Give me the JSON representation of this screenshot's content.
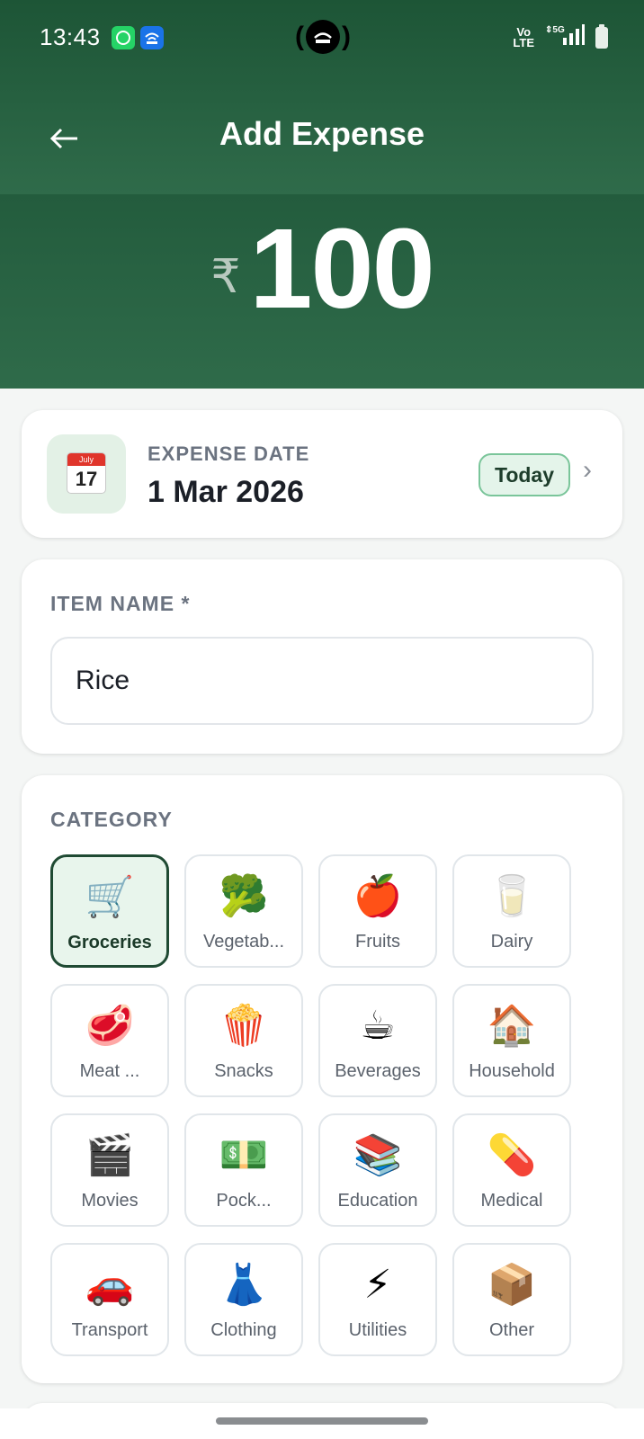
{
  "status_bar": {
    "time": "13:43",
    "network_volte": "Vo\nLTE",
    "network_type": "5G"
  },
  "header": {
    "title": "Add Expense",
    "back_icon": "arrow-left-icon",
    "currency_symbol": "₹",
    "amount": "100"
  },
  "date_card": {
    "label": "EXPENSE DATE",
    "value": "1 Mar 2026",
    "calendar_month": "July",
    "calendar_day": "17",
    "badge": "Today",
    "chevron": "›"
  },
  "item_card": {
    "label": "ITEM NAME *",
    "value": "Rice"
  },
  "category_card": {
    "label": "CATEGORY",
    "selected": "Groceries",
    "items": [
      {
        "label": "Groceries",
        "emoji": "🛒",
        "icon": "shopping-cart-icon"
      },
      {
        "label": "Vegetab...",
        "emoji": "🥦",
        "icon": "broccoli-icon"
      },
      {
        "label": "Fruits",
        "emoji": "🍎",
        "icon": "apple-icon"
      },
      {
        "label": "Dairy",
        "emoji": "🥛",
        "icon": "milk-glass-icon"
      },
      {
        "label": "Meat ...",
        "emoji": "🥩",
        "icon": "meat-icon"
      },
      {
        "label": "Snacks",
        "emoji": "🍿",
        "icon": "popcorn-icon"
      },
      {
        "label": "Beverages",
        "emoji": "☕",
        "icon": "coffee-icon"
      },
      {
        "label": "Household",
        "emoji": "🏠",
        "icon": "house-icon"
      },
      {
        "label": "Movies",
        "emoji": "🎬",
        "icon": "clapperboard-icon"
      },
      {
        "label": "Pock...",
        "emoji": "💵",
        "icon": "banknote-icon"
      },
      {
        "label": "Education",
        "emoji": "📚",
        "icon": "books-icon"
      },
      {
        "label": "Medical",
        "emoji": "💊",
        "icon": "pill-icon"
      },
      {
        "label": "Transport",
        "emoji": "🚗",
        "icon": "car-icon"
      },
      {
        "label": "Clothing",
        "emoji": "👗",
        "icon": "dress-icon"
      },
      {
        "label": "Utilities",
        "emoji": "⚡",
        "icon": "lightning-icon"
      },
      {
        "label": "Other",
        "emoji": "📦",
        "icon": "package-icon"
      }
    ]
  },
  "colors": {
    "header_green": "#2d6a48",
    "accent_green": "#1f4a33",
    "badge_bg": "#e4f4ea"
  }
}
